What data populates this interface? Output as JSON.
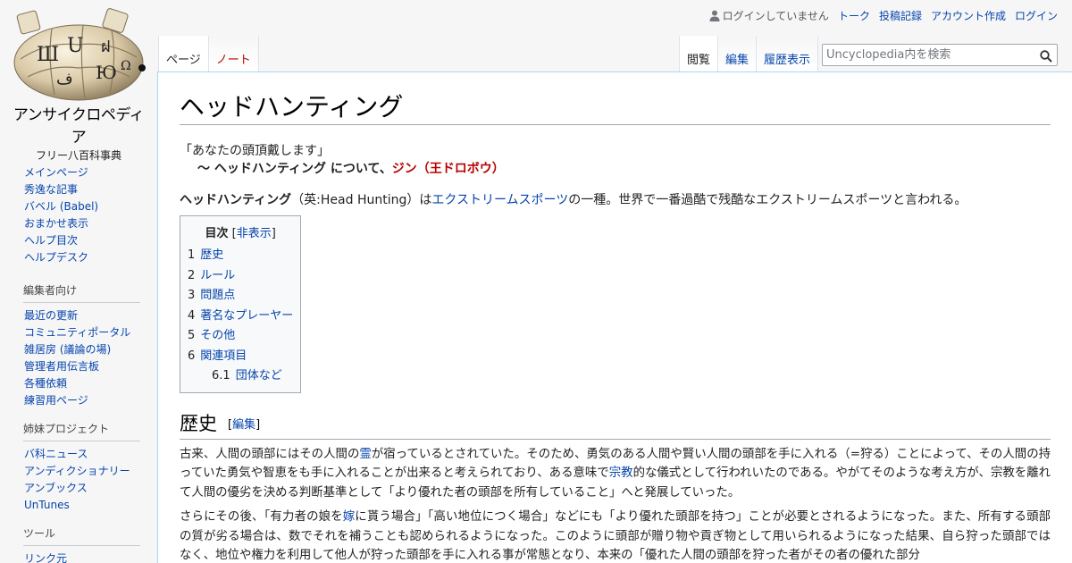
{
  "site": {
    "name": "アンサイクロペディア",
    "tagline": "フリー八百科事典"
  },
  "personal": {
    "anon": "ログインしていません",
    "talk": "トーク",
    "contribs": "投稿記録",
    "create_account": "アカウント作成",
    "login": "ログイン"
  },
  "tabs": {
    "page": "ページ",
    "note": "ノート",
    "view": "閲覧",
    "edit": "編集",
    "history": "履歴表示"
  },
  "search": {
    "placeholder": "Uncyclopedia内を検索"
  },
  "nav": {
    "main": [
      "メインページ",
      "秀逸な記事",
      "バベル (Babel)",
      "おまかせ表示",
      "ヘルプ目次",
      "ヘルプデスク"
    ],
    "editors_title": "編集者向け",
    "editors": [
      "最近の更新",
      "コミュニティポータル",
      "雑居房 (議論の場)",
      "管理者用伝言板",
      "各種依頼",
      "練習用ページ"
    ],
    "sister_title": "姉妹プロジェクト",
    "sister": [
      "バ科ニュース",
      "アンディクショナリー",
      "アンブックス",
      "UnTunes"
    ],
    "tools_title": "ツール",
    "tools": [
      "リンク元"
    ]
  },
  "article": {
    "title": "ヘッドハンティング",
    "quote_line": "「あなたの頭頂戴します」",
    "quote_prefix": "〜 ヘッドハンティング について、",
    "quote_author": "ジン（王ドロボウ）",
    "intro_bold": "ヘッドハンティング",
    "intro_a": "（英:Head Hunting）は",
    "intro_link": "エクストリームスポーツ",
    "intro_b": "の一種。世界で一番過酷で残酷なエクストリームスポーツと言われる。",
    "toc": {
      "title": "目次",
      "toggle_open": "[",
      "toggle": "非表示",
      "toggle_close": "]",
      "items": [
        {
          "num": "1",
          "label": "歴史"
        },
        {
          "num": "2",
          "label": "ルール"
        },
        {
          "num": "3",
          "label": "問題点"
        },
        {
          "num": "4",
          "label": "著名なプレーヤー"
        },
        {
          "num": "5",
          "label": "その他"
        },
        {
          "num": "6",
          "label": "関連項目"
        },
        {
          "num": "6.1",
          "label": "団体など"
        }
      ]
    },
    "section1": {
      "heading": "歴史",
      "edit_open": "[",
      "edit": "編集",
      "edit_close": "]",
      "p1_a": "古来、人間の頭部にはその人間の",
      "p1_link1": "霊",
      "p1_b": "が宿っているとされていた。そのため、勇気のある人間や賢い人間の頭部を手に入れる（=狩る）ことによって、その人間の持っていた勇気や智恵をも手に入れることが出来ると考えられており、ある意味で",
      "p1_link2": "宗教",
      "p1_c": "的な儀式として行われいたのである。やがてそのような考え方が、宗教を離れて人間の優劣を決める判断基準として「より優れた者の頭部を所有していること」へと発展していった。",
      "p2_a": "さらにその後、「有力者の娘を",
      "p2_link1": "嫁",
      "p2_b": "に貰う場合」「高い地位につく場合」などにも「より優れた頭部を持つ」ことが必要とされるようになった。また、所有する頭部の質が劣る場合は、数でそれを補うことも認められるようになった。このように頭部が贈り物や貢ぎ物として用いられるようになった結果、自ら狩った頭部ではなく、地位や権力を利用して他人が狩った頭部を手に入れる事が常態となり、本来の「優れた人間の頭部を狩った者がその者の優れた部分"
    }
  }
}
